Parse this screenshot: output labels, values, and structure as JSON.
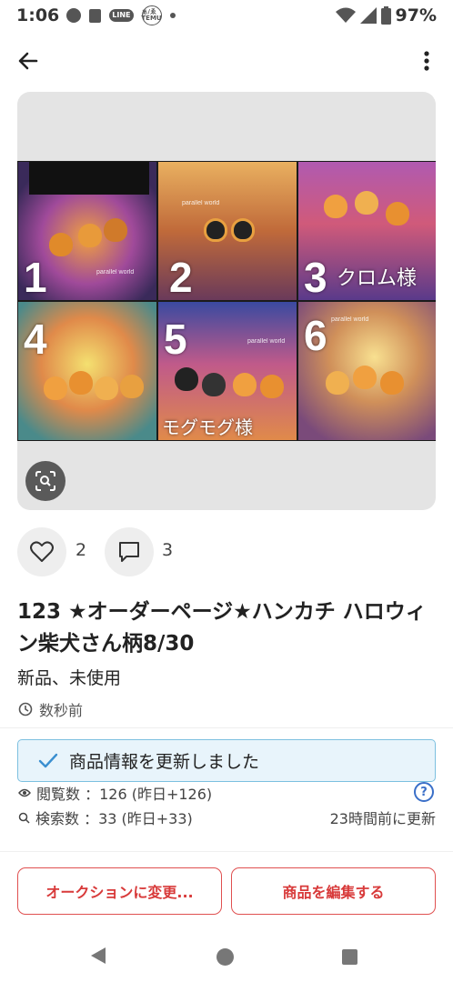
{
  "status_bar": {
    "time": "1:06",
    "line_badge": "LINE",
    "temu_badge": "ぁ/ゑ TEMU",
    "battery": "97%"
  },
  "colors": {
    "accent_red": "#d83a3a",
    "toast_bg": "#e8f4fb",
    "toast_border": "#7cc0e0",
    "check_blue": "#3a8fd0",
    "help_blue": "#3a6fc8"
  },
  "image": {
    "tiles": [
      {
        "number": "1",
        "name": "",
        "watermark": "parallel world"
      },
      {
        "number": "2",
        "name": "",
        "watermark": "parallel world"
      },
      {
        "number": "3",
        "name": "クロム様",
        "watermark": ""
      },
      {
        "number": "4",
        "name": "",
        "watermark": ""
      },
      {
        "number": "5",
        "name": "モグモグ様",
        "watermark": "parallel world"
      },
      {
        "number": "6",
        "name": "",
        "watermark": "parallel world"
      }
    ]
  },
  "reactions": {
    "likes": "2",
    "comments": "3"
  },
  "product": {
    "title": "123 ★オーダーページ★ハンカチ ハロウィン柴犬さん柄8/30",
    "condition": "新品、未使用",
    "posted": "数秒前"
  },
  "toast": {
    "message": "商品情報を更新しました"
  },
  "stats": {
    "views": "閲覧数 ：126 (昨日+126)",
    "searches": "検索数 ：33 (昨日+33)",
    "updated": "23時間前に更新",
    "help": "?"
  },
  "actions": {
    "auction": "オークションに変更...",
    "edit": "商品を編集する"
  },
  "icons": [
    "back-arrow-icon",
    "more-vert-icon",
    "lens-scan-icon",
    "heart-icon",
    "comment-icon",
    "clock-icon",
    "eye-icon",
    "search-icon",
    "check-icon",
    "help-icon"
  ]
}
